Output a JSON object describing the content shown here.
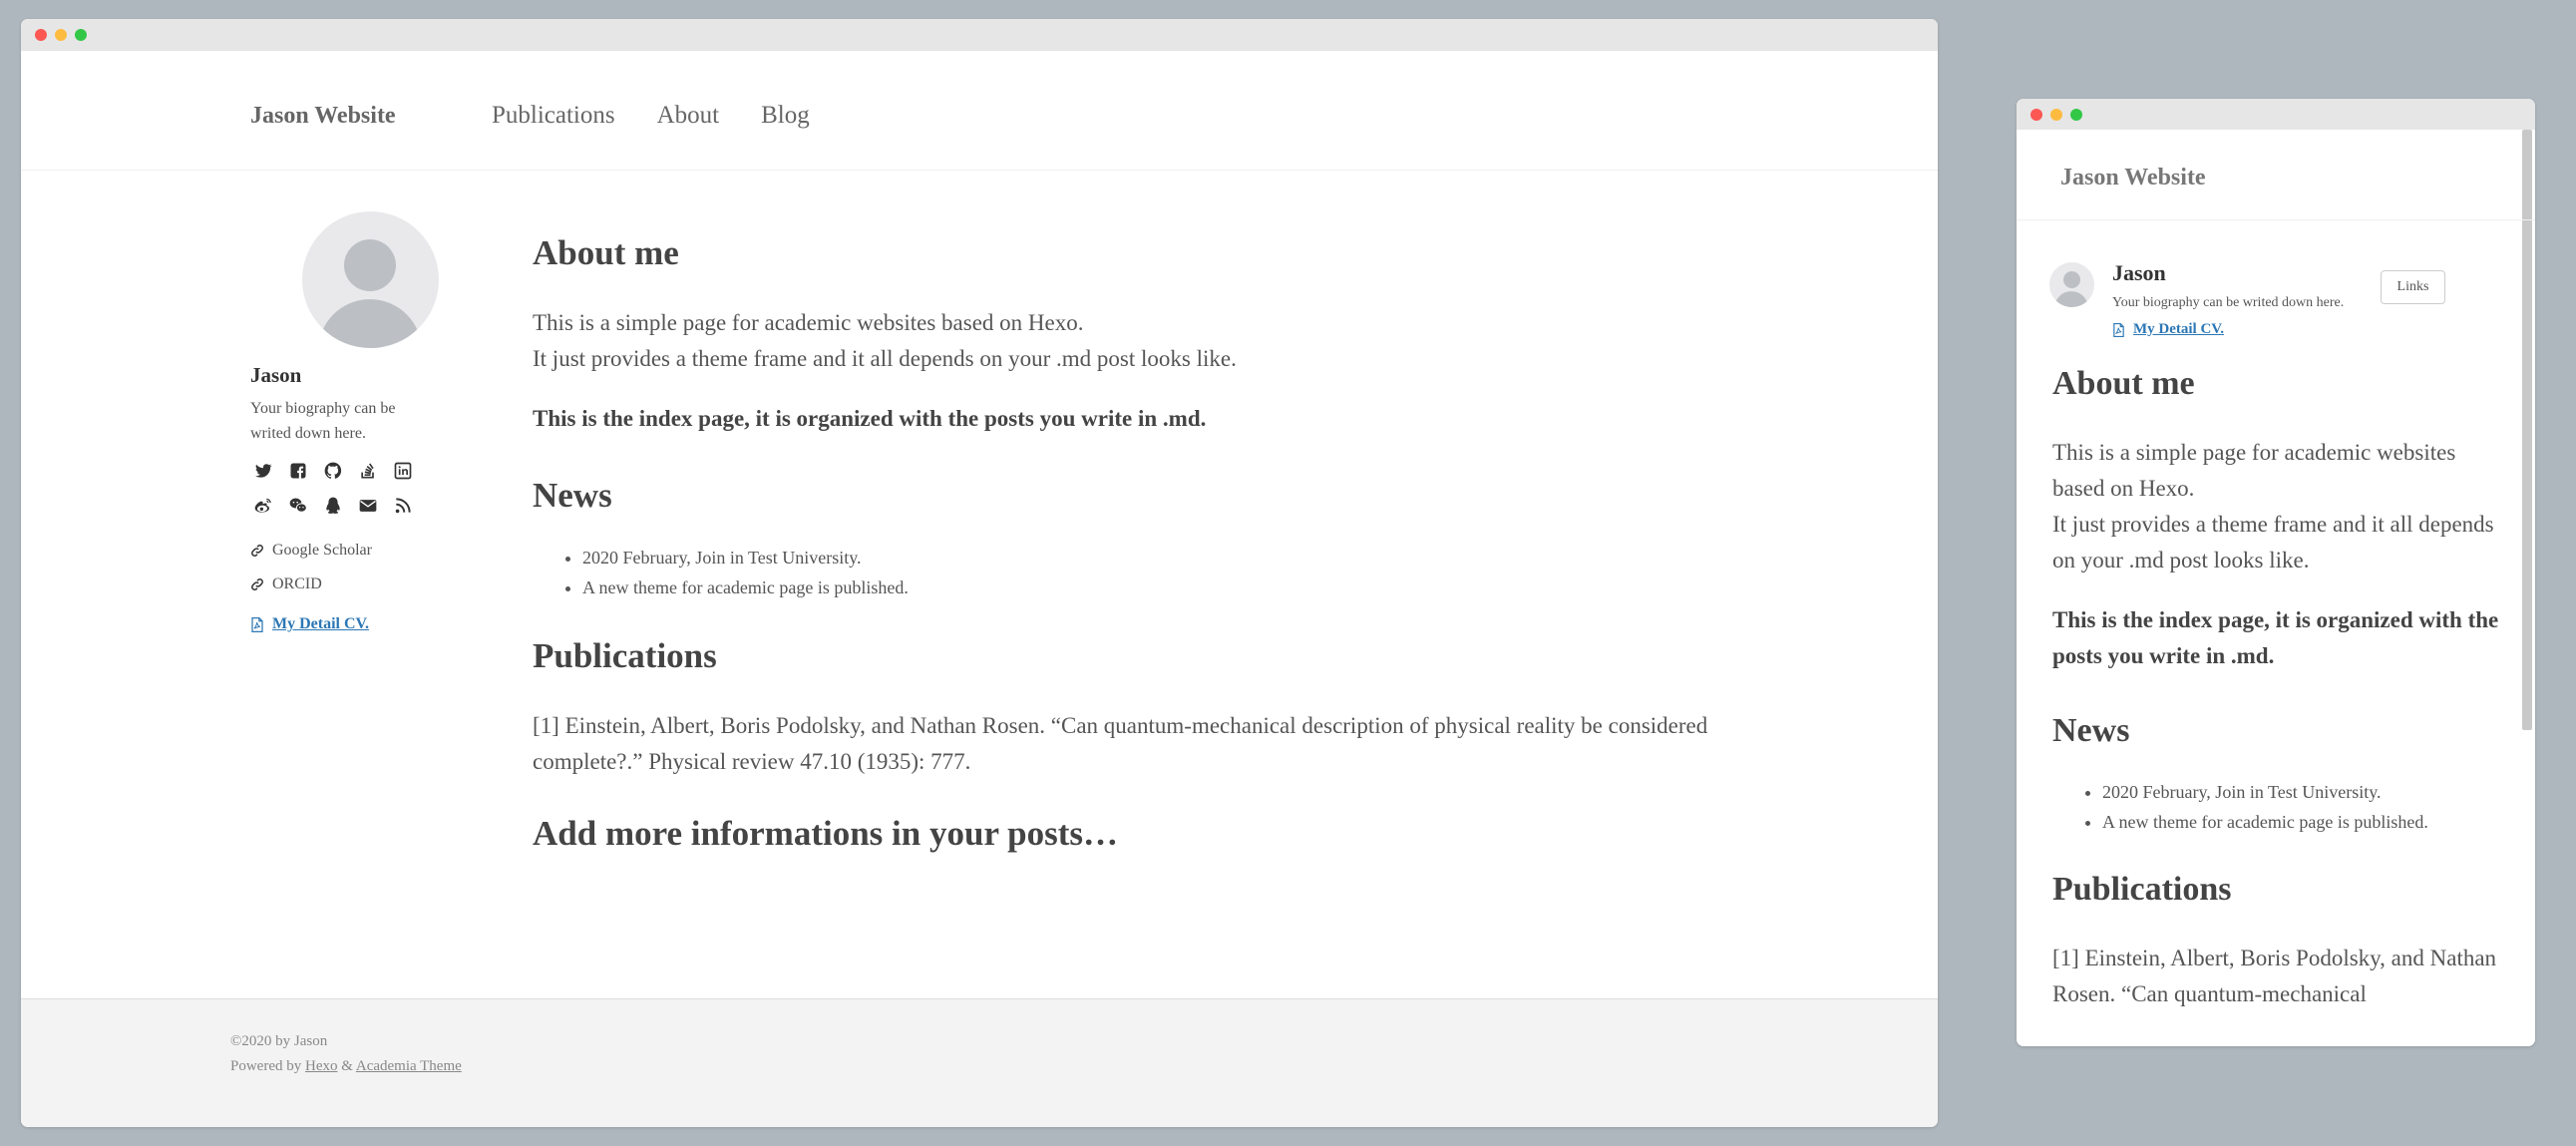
{
  "site": {
    "brand": "Jason Website",
    "nav": [
      "Publications",
      "About",
      "Blog"
    ]
  },
  "profile": {
    "name": "Jason",
    "bio": "Your biography can be writed down here.",
    "social_icons_row1": [
      "twitter-icon",
      "facebook-icon",
      "github-icon",
      "stackoverflow-icon",
      "linkedin-icon"
    ],
    "social_icons_row2": [
      "weibo-icon",
      "wechat-icon",
      "qq-icon",
      "email-icon",
      "rss-icon"
    ],
    "links": [
      "Google Scholar",
      "ORCID"
    ],
    "cv_label": "My Detail CV.",
    "links_button": "Links"
  },
  "content": {
    "about_heading": "About me",
    "about_line1": "This is a simple page for academic websites based on Hexo.",
    "about_line2": "It just provides a theme frame and it all depends on your .md post looks like.",
    "about_bold": "This is the index page, it is organized with the posts you write in .md.",
    "news_heading": "News",
    "news_items": [
      "2020 February, Join in Test University.",
      "A new theme for academic page is published."
    ],
    "pub_heading": "Publications",
    "pub_item": "[1] Einstein, Albert, Boris Podolsky, and Nathan Rosen. “Can quantum-mechanical description of physical reality be considered complete?.” Physical review 47.10 (1935): 777.",
    "more_heading": "Add more informations in your posts…"
  },
  "mobile": {
    "about_line1": "This is a simple page for academic websites based on Hexo.",
    "about_line2": "It just provides a theme frame and it all depends on your .md post looks like.",
    "pub_item_partial": "[1] Einstein, Albert, Boris Podolsky, and Nathan Rosen. “Can quantum-mechanical"
  },
  "footer": {
    "copyright": "©2020 by Jason",
    "powered_prefix": "Powered by",
    "hexo": "Hexo",
    "amp": "&",
    "theme": "Academia Theme"
  },
  "colors": {
    "background": "#aeb7bd",
    "link": "#2c77b5",
    "close": "#fc5753",
    "minimize": "#fdbc40",
    "maximize": "#33c748"
  }
}
